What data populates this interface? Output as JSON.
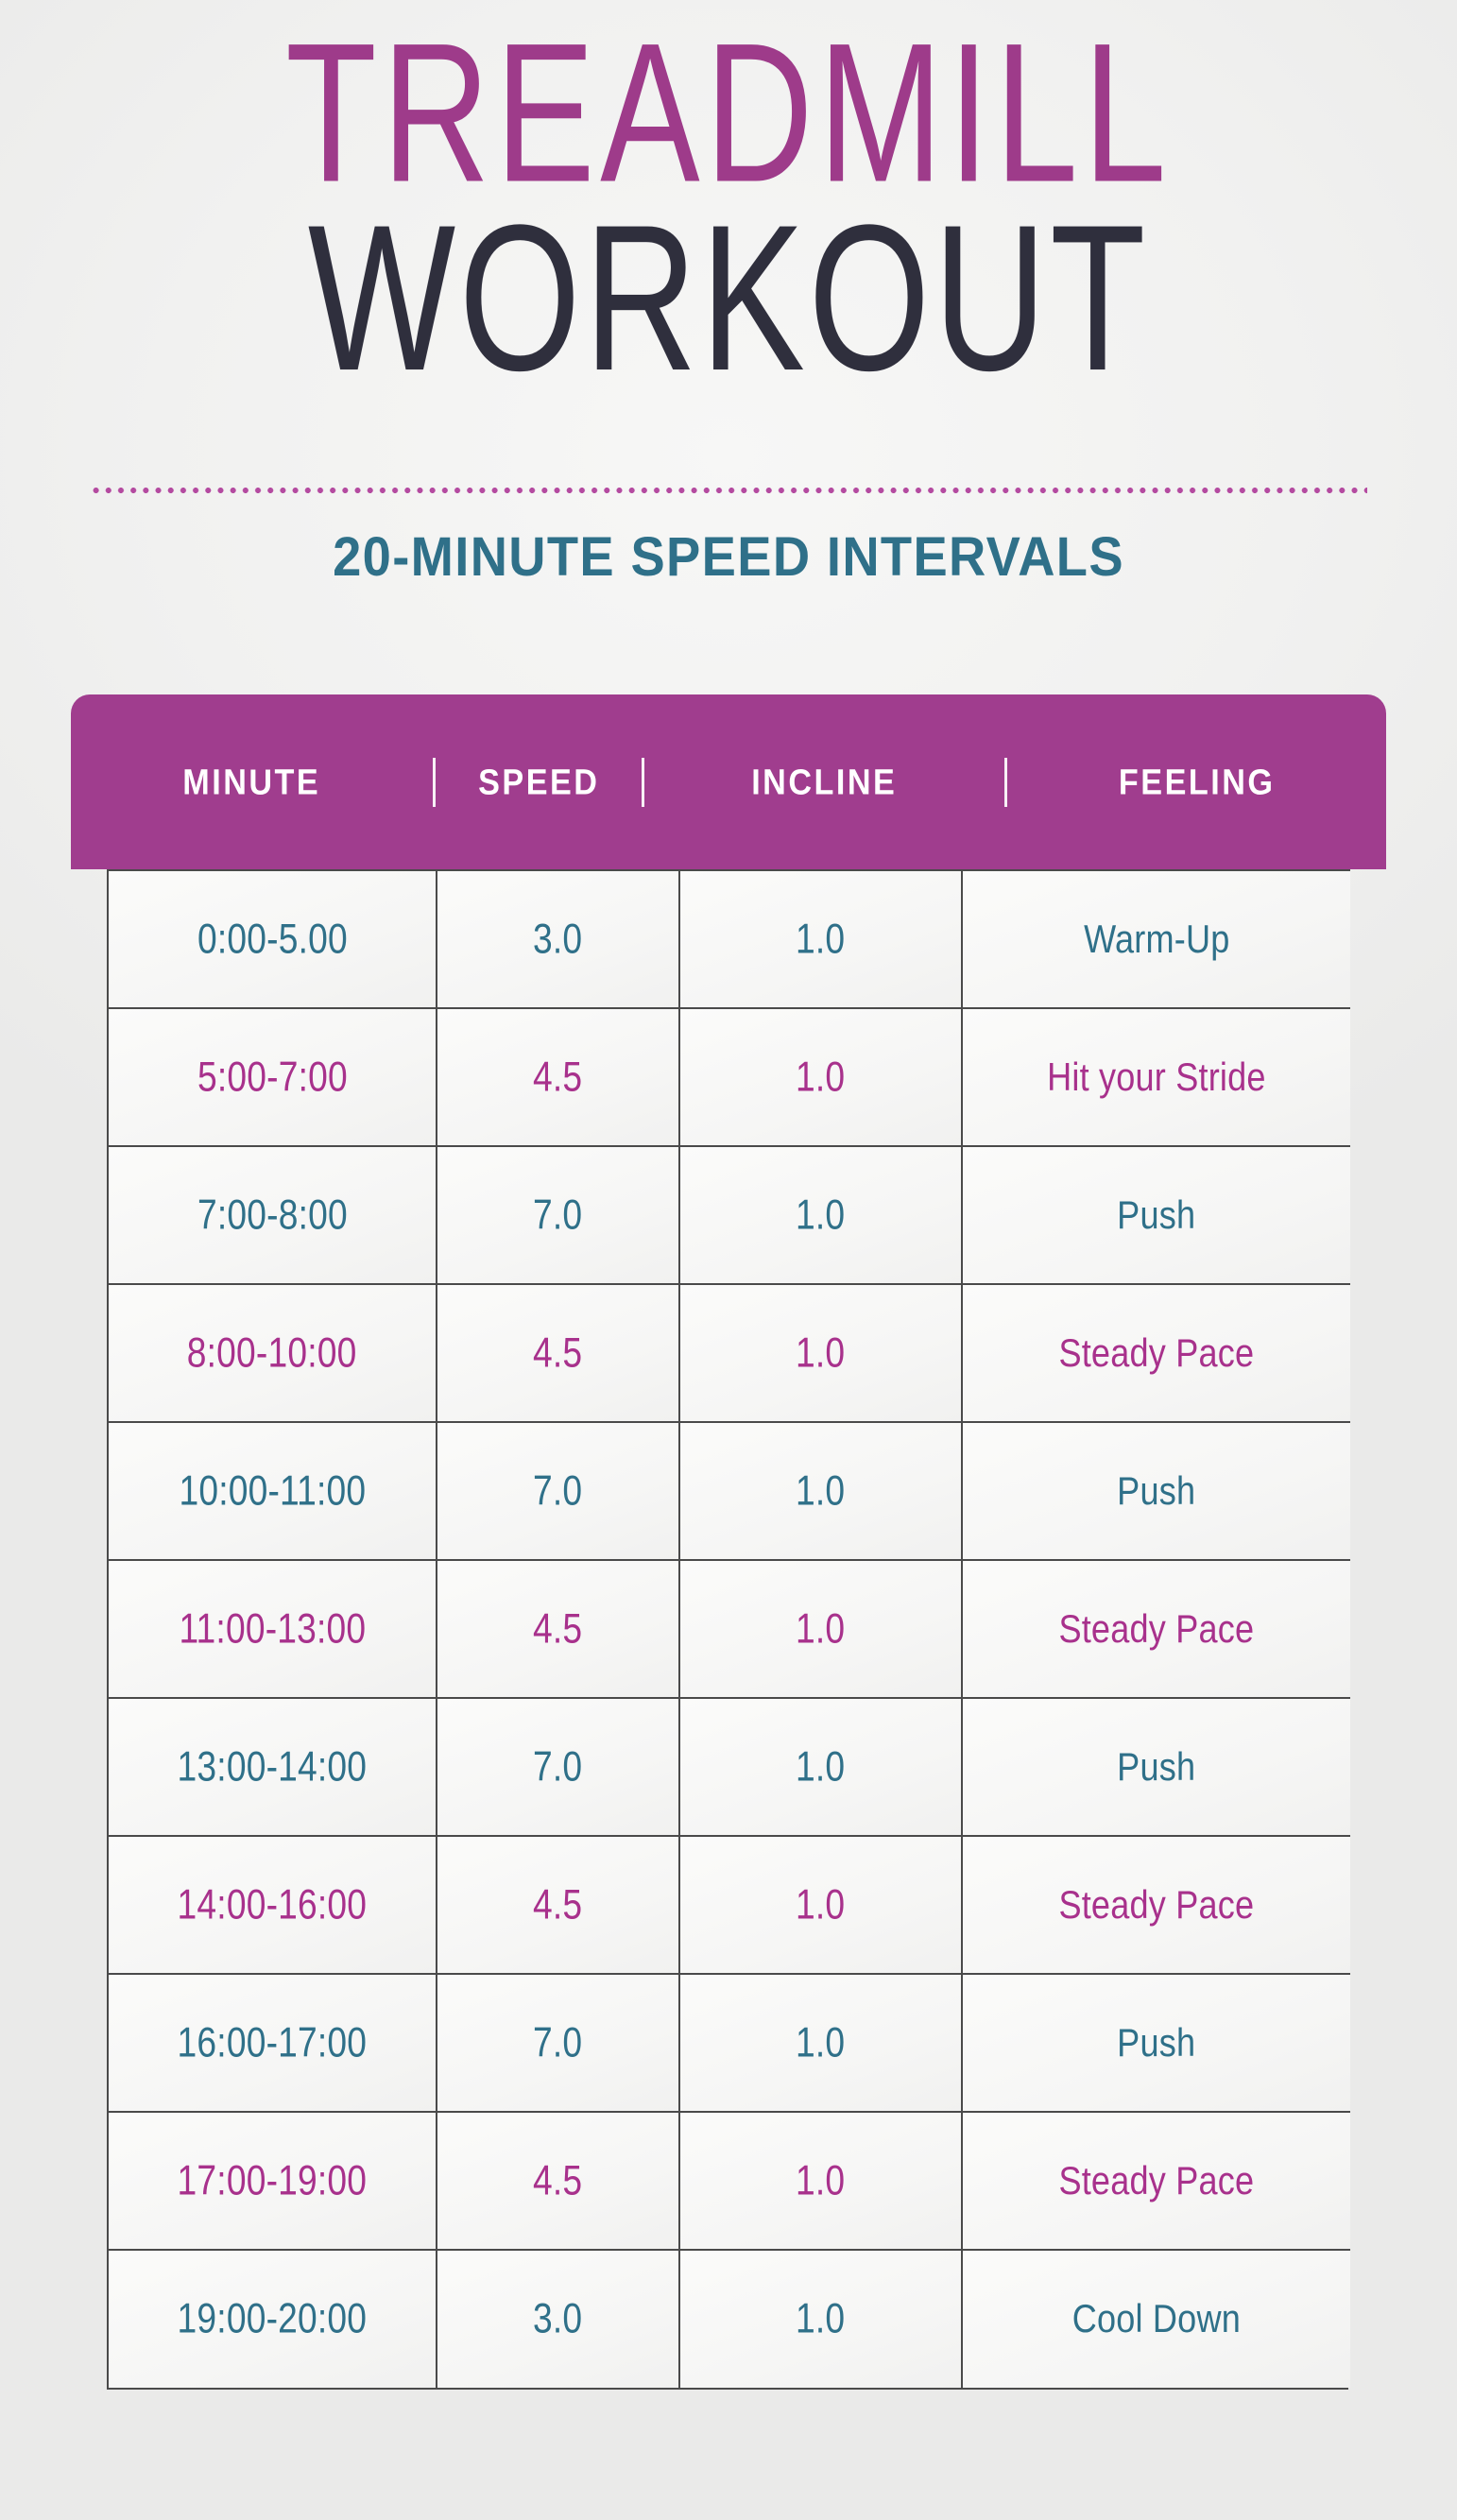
{
  "title": {
    "line1": "TREADMILL",
    "line2": "WORKOUT",
    "line1_color": "#9e3b8a",
    "line2_color": "#2f2f3d"
  },
  "divider": {
    "style": "dotted",
    "color": "#b44aa0"
  },
  "subtitle": {
    "text": "20-MINUTE SPEED INTERVALS",
    "color": "#2f7089"
  },
  "table": {
    "header_bg": "#a03d8e",
    "header_text_color": "#ffffff",
    "columns": [
      {
        "key": "minute",
        "label": "MINUTE"
      },
      {
        "key": "speed",
        "label": "SPEED"
      },
      {
        "key": "incline",
        "label": "INCLINE"
      },
      {
        "key": "feeling",
        "label": "FEELING"
      }
    ],
    "row_colors": {
      "teal": "#2f7089",
      "magenta": "#a8318c"
    },
    "rows": [
      {
        "minute": "0:00-5.00",
        "speed": "3.0",
        "incline": "1.0",
        "feeling": "Warm-Up",
        "color": "teal"
      },
      {
        "minute": "5:00-7:00",
        "speed": "4.5",
        "incline": "1.0",
        "feeling": "Hit your Stride",
        "color": "magenta"
      },
      {
        "minute": "7:00-8:00",
        "speed": "7.0",
        "incline": "1.0",
        "feeling": "Push",
        "color": "teal"
      },
      {
        "minute": "8:00-10:00",
        "speed": "4.5",
        "incline": "1.0",
        "feeling": "Steady Pace",
        "color": "magenta"
      },
      {
        "minute": "10:00-11:00",
        "speed": "7.0",
        "incline": "1.0",
        "feeling": "Push",
        "color": "teal"
      },
      {
        "minute": "11:00-13:00",
        "speed": "4.5",
        "incline": "1.0",
        "feeling": "Steady Pace",
        "color": "magenta"
      },
      {
        "minute": "13:00-14:00",
        "speed": "7.0",
        "incline": "1.0",
        "feeling": "Push",
        "color": "teal"
      },
      {
        "minute": "14:00-16:00",
        "speed": "4.5",
        "incline": "1.0",
        "feeling": "Steady Pace",
        "color": "magenta"
      },
      {
        "minute": "16:00-17:00",
        "speed": "7.0",
        "incline": "1.0",
        "feeling": "Push",
        "color": "teal"
      },
      {
        "minute": "17:00-19:00",
        "speed": "4.5",
        "incline": "1.0",
        "feeling": "Steady Pace",
        "color": "magenta"
      },
      {
        "minute": "19:00-20:00",
        "speed": "3.0",
        "incline": "1.0",
        "feeling": "Cool Down",
        "color": "teal"
      }
    ]
  }
}
